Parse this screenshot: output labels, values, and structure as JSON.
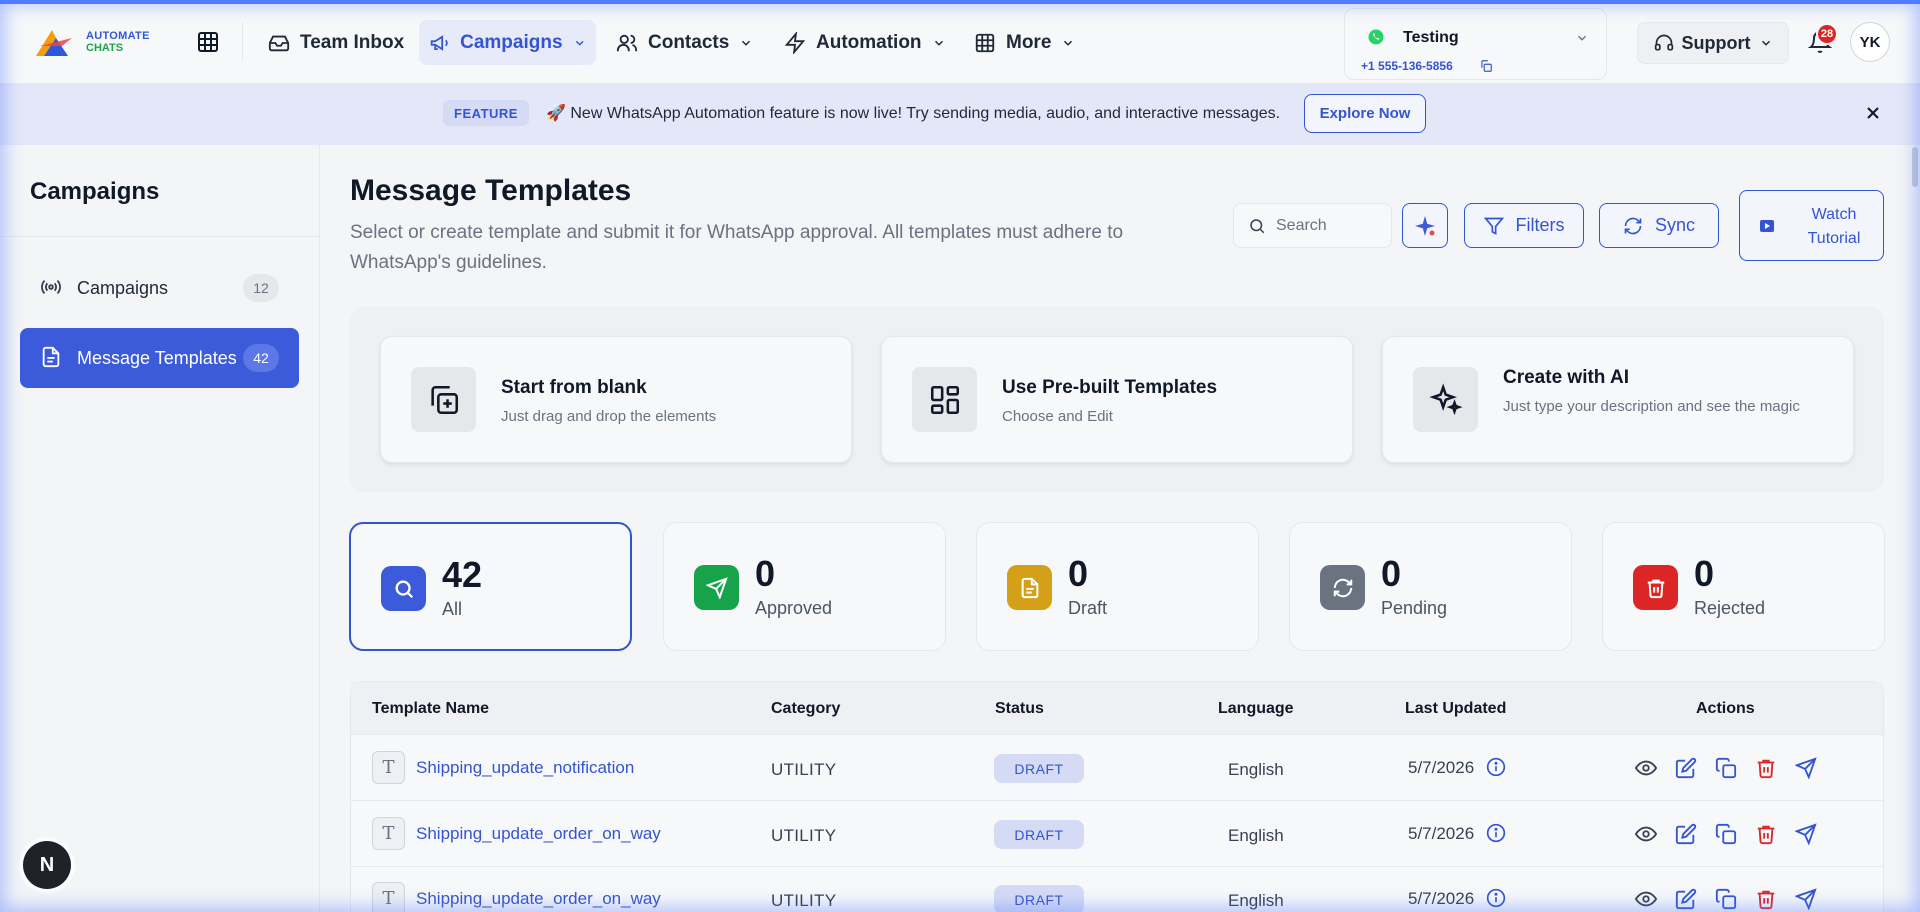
{
  "brand": {
    "logo_line1": "AUTOMATE",
    "logo_line2": "CHATS"
  },
  "nav": {
    "items": [
      {
        "label": "Team Inbox"
      },
      {
        "label": "Campaigns"
      },
      {
        "label": "Contacts"
      },
      {
        "label": "Automation"
      },
      {
        "label": "More"
      }
    ],
    "account": {
      "name": "Testing",
      "phone": "+1 555-136-5856"
    },
    "support_label": "Support",
    "notification_count": "28",
    "avatar_initials": "YK"
  },
  "banner": {
    "tag": "FEATURE",
    "message": "🚀 New WhatsApp Automation feature is now live! Try sending media, audio, and interactive messages.",
    "cta": "Explore Now"
  },
  "sidebar": {
    "title": "Campaigns",
    "items": [
      {
        "label": "Campaigns",
        "count": "12"
      },
      {
        "label": "Message Templates",
        "count": "42"
      }
    ]
  },
  "page": {
    "title": "Message Templates",
    "subtitle": "Select or create template and submit it for WhatsApp approval. All templates must adhere to WhatsApp's guidelines.",
    "search_placeholder": "Search",
    "filters_label": "Filters",
    "sync_label": "Sync",
    "watch_label": "Watch Tutorial"
  },
  "create_options": [
    {
      "title": "Start from blank",
      "subtitle": "Just drag and drop the elements"
    },
    {
      "title": "Use Pre-built Templates",
      "subtitle": "Choose and Edit"
    },
    {
      "title": "Create with AI",
      "subtitle": "Just type your description and see the magic"
    }
  ],
  "stats": [
    {
      "value": "42",
      "label": "All",
      "color": "#3b5bdb"
    },
    {
      "value": "0",
      "label": "Approved",
      "color": "#16a34a"
    },
    {
      "value": "0",
      "label": "Draft",
      "color": "#d4a017"
    },
    {
      "value": "0",
      "label": "Pending",
      "color": "#6b7280"
    },
    {
      "value": "0",
      "label": "Rejected",
      "color": "#dc2626"
    }
  ],
  "table": {
    "headers": [
      "Template Name",
      "Category",
      "Status",
      "Language",
      "Last Updated",
      "Actions"
    ],
    "rows": [
      {
        "name": "Shipping_update_notification",
        "category": "UTILITY",
        "status": "DRAFT",
        "language": "English",
        "updated": "5/7/2026"
      },
      {
        "name": "Shipping_update_order_on_way",
        "category": "UTILITY",
        "status": "DRAFT",
        "language": "English",
        "updated": "5/7/2026"
      },
      {
        "name": "Shipping_update_order_on_way",
        "category": "UTILITY",
        "status": "DRAFT",
        "language": "English",
        "updated": "5/7/2026"
      }
    ]
  },
  "dev_badge": "N",
  "colors": {
    "accent": "#3454d1",
    "danger": "#dc2626",
    "whatsapp": "#25d366"
  }
}
